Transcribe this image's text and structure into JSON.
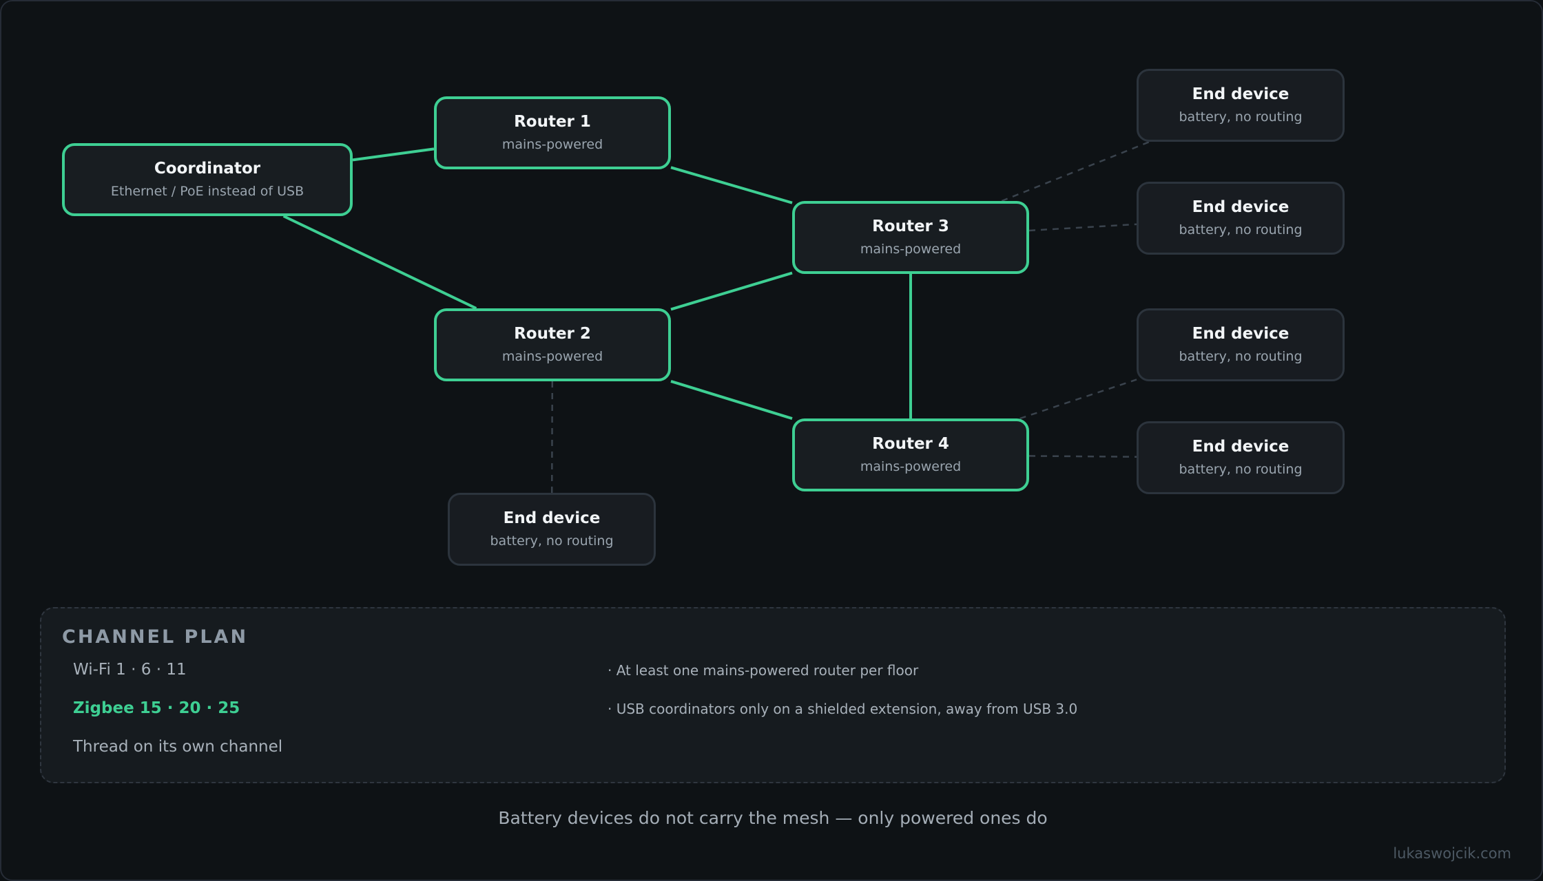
{
  "nodes": {
    "coordinator": {
      "title": "Coordinator",
      "subtitle": "Ethernet / PoE instead of USB"
    },
    "router1": {
      "title": "Router 1",
      "subtitle": "mains-powered"
    },
    "router2": {
      "title": "Router 2",
      "subtitle": "mains-powered"
    },
    "router3": {
      "title": "Router 3",
      "subtitle": "mains-powered"
    },
    "router4": {
      "title": "Router 4",
      "subtitle": "mains-powered"
    },
    "end1": {
      "title": "End device",
      "subtitle": "battery, no routing"
    },
    "end2": {
      "title": "End device",
      "subtitle": "battery, no routing"
    },
    "end3": {
      "title": "End device",
      "subtitle": "battery, no routing"
    },
    "end4": {
      "title": "End device",
      "subtitle": "battery, no routing"
    },
    "end5": {
      "title": "End device",
      "subtitle": "battery, no routing"
    }
  },
  "links": {
    "mesh": [
      [
        "coordinator",
        "router1"
      ],
      [
        "coordinator",
        "router2"
      ],
      [
        "router1",
        "router3"
      ],
      [
        "router2",
        "router3"
      ],
      [
        "router2",
        "router4"
      ],
      [
        "router3",
        "router4"
      ]
    ],
    "battery": [
      [
        "router3",
        "end1"
      ],
      [
        "router3",
        "end2"
      ],
      [
        "router4",
        "end3"
      ],
      [
        "router4",
        "end4"
      ],
      [
        "router2",
        "end5"
      ]
    ]
  },
  "colors": {
    "mesh": "#3ecf93",
    "battery": "#3a434d"
  },
  "plan": {
    "title": "CHANNEL PLAN",
    "wifi": "Wi-Fi 1 · 6 · 11",
    "zigbee": "Zigbee 15 · 20 · 25",
    "thread": "Thread on its own channel",
    "rule1": "· At least one mains-powered router per floor",
    "rule2": "· USB coordinators only on a shielded extension, away from USB 3.0"
  },
  "caption": "Battery devices do not carry the mesh — only powered ones do",
  "credit": "lukaswojcik.com"
}
